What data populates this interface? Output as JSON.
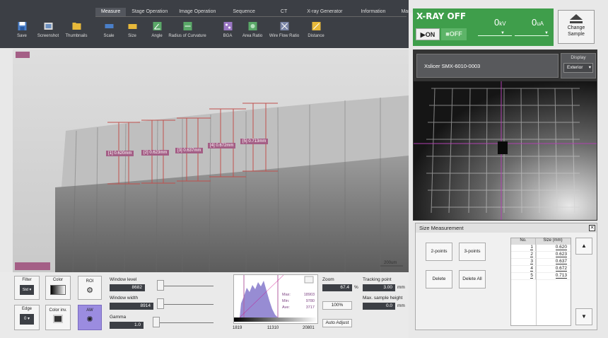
{
  "menu": {
    "items": [
      "Measure",
      "Stage Operation",
      "Image Operation",
      "Sequence",
      "CT",
      "X-ray Generator",
      "Information",
      "Manage"
    ],
    "active_index": 0
  },
  "toolbar": {
    "buttons": [
      {
        "label": "Save",
        "icon": "save-icon"
      },
      {
        "label": "Screenshot",
        "icon": "screenshot-icon"
      },
      {
        "label": "Thumbnails",
        "icon": "thumbnails-icon"
      },
      {
        "label": "Scale",
        "icon": "scale-icon"
      },
      {
        "label": "Size",
        "icon": "size-icon"
      },
      {
        "label": "Angle",
        "icon": "angle-icon"
      },
      {
        "label": "Radius of Curvature",
        "icon": "radius-icon"
      },
      {
        "label": "BGA",
        "icon": "bga-icon"
      },
      {
        "label": "Area Ratio",
        "icon": "area-ratio-icon"
      },
      {
        "label": "Wire Flow Ratio",
        "icon": "wire-flow-icon"
      },
      {
        "label": "Distance",
        "icon": "distance-icon"
      }
    ]
  },
  "xray": {
    "title": "X-RAY OFF",
    "on_label": "ON",
    "off_label": "OFF",
    "kv_value": "0",
    "kv_unit": "kV",
    "ua_value": "0",
    "ua_unit": "uA",
    "color": "#3f9e4b"
  },
  "change_sample": {
    "line1": "Change",
    "line2": "Sample"
  },
  "image": {
    "measurements": [
      {
        "label": "[1] 0.620mm"
      },
      {
        "label": "[2] 0.623mm"
      },
      {
        "label": "[3] 0.637mm"
      },
      {
        "label": "[4] 0.672mm"
      },
      {
        "label": "[5] 0.713mm"
      }
    ],
    "scale_label": "200um",
    "accent": "#c0504d"
  },
  "camera": {
    "title": "Xslicer SMX-6010-0003",
    "display_label": "Display",
    "display_value": "Exterior"
  },
  "size_measurement": {
    "title": "Size Measurement",
    "btn_2points": "2-points",
    "btn_3points": "3-points",
    "btn_delete": "Delete",
    "btn_delete_all": "Delete All",
    "col_no": "No.",
    "col_size": "Size (mm)",
    "rows": [
      {
        "no": "1",
        "size": "0.620"
      },
      {
        "no": "2",
        "size": "0.623"
      },
      {
        "no": "3",
        "size": "0.637"
      },
      {
        "no": "4",
        "size": "0.672"
      },
      {
        "no": "5",
        "size": "0.713"
      }
    ]
  },
  "controls": {
    "filter_label": "Filter",
    "filter_value": "Std",
    "color_label": "Color",
    "roi_label": "ROI",
    "edge_label": "Edge",
    "edge_value": "0",
    "color_inv_label": "Color inv.",
    "aw_label": "AW",
    "window_level_label": "Window level",
    "window_level_value": "8682",
    "window_width_label": "Window width",
    "window_width_value": "8914",
    "gamma_label": "Gamma",
    "gamma_value": "1.0",
    "hist_max_label": "Max:",
    "hist_max_value": "18903",
    "hist_min_label": "Min:",
    "hist_min_value": "9780",
    "hist_ave_label": "Ave:",
    "hist_ave_value": "3717",
    "hist_x_min": "1819",
    "hist_x_mid": "11310",
    "hist_x_max": "20801",
    "zoom_label": "Zoom",
    "zoom_value": "67.4",
    "zoom_unit": "%",
    "btn_100": "100%",
    "btn_auto_adjust": "Auto Adjust",
    "tracking_label": "Tracking point",
    "tracking_value": "3.00",
    "tracking_unit": "mm",
    "max_sample_label": "Max. sample height",
    "max_sample_value": "0.0",
    "max_sample_unit": "mm"
  }
}
